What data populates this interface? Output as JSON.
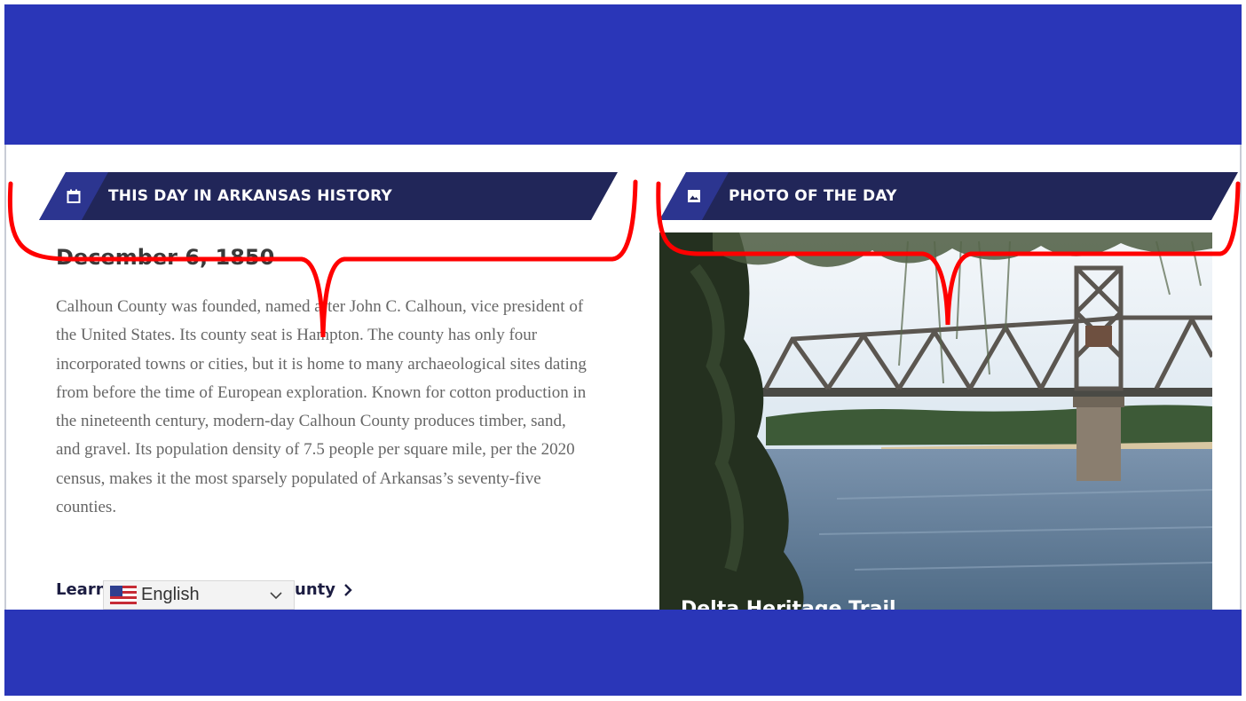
{
  "left_panel": {
    "title": "THIS DAY IN ARKANSAS HISTORY",
    "icon": "calendar-icon",
    "date": "December 6, 1850",
    "body": "Calhoun County was founded, named after John C. Calhoun, vice president of the United States. Its county seat is Hampton. The county has only four incorporated towns or cities, but it is home to many archaeological sites dating from before the time of European exploration. Known for cotton production in the nineteenth century, modern-day Calhoun County produces timber, sand, and gravel. Its population density of 7.5 people per square mile, per the 2020 census, makes it the most sparsely populated of Arkansas’s seventy-five counties.",
    "learn_more_start": "Learn",
    "learn_more_end": "unty"
  },
  "right_panel": {
    "title": "PHOTO OF THE DAY",
    "icon": "image-icon",
    "caption": "Delta Heritage Trail"
  },
  "language_selector": {
    "flag": "us-flag-icon",
    "selected": "English"
  },
  "colors": {
    "band_blue": "#2a36b8",
    "banner_navy": "#212659",
    "annotation_red": "#ff0000"
  }
}
